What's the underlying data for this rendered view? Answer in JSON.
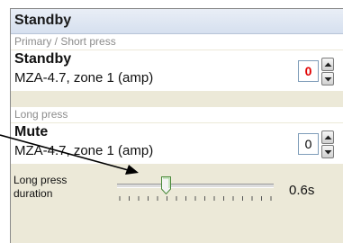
{
  "panel": {
    "title": "Standby",
    "primary_section": "Primary / Short press",
    "primary": {
      "name": "Standby",
      "detail": "MZA-4.7, zone 1 (amp)",
      "value": "0",
      "value_color": "#e00000"
    },
    "long_section": "Long press",
    "long": {
      "name": "Mute",
      "detail": "MZA-4.7, zone 1 (amp)",
      "value": "0"
    },
    "duration": {
      "label_line1": "Long press",
      "label_line2": "duration",
      "value_text": "0.6s",
      "slider_fraction": 0.31
    }
  },
  "icons": {
    "spinner_up": "arrow-up-icon",
    "spinner_down": "arrow-down-icon",
    "callout": "callout-arrow-icon"
  }
}
